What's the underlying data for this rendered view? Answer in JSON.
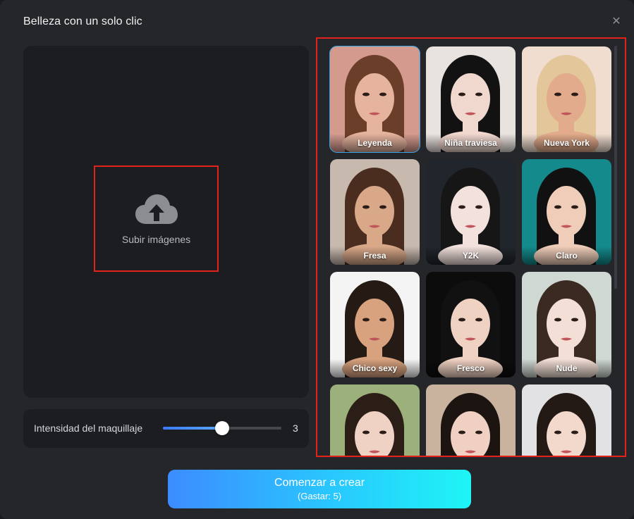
{
  "dialog": {
    "title": "Belleza con un solo clic",
    "close_glyph": "✕"
  },
  "upload": {
    "label": "Subir imágenes",
    "icon": "cloud-upload-icon"
  },
  "intensity": {
    "label": "Intensidad del maquillaje",
    "value": "3",
    "level_fraction": 0.5
  },
  "styles": [
    {
      "label": "Leyenda",
      "selected": true,
      "bg": "#d49a8e",
      "skin": "#e5b39e",
      "hair": "#6b3e2a"
    },
    {
      "label": "Niña traviesa",
      "selected": false,
      "bg": "#e9e3df",
      "skin": "#f1d8cf",
      "hair": "#121212"
    },
    {
      "label": "Nueva York",
      "selected": false,
      "bg": "#f0ddd0",
      "skin": "#e2ab8b",
      "hair": "#e3c79a"
    },
    {
      "label": "Fresa",
      "selected": false,
      "bg": "#c8b9ae",
      "skin": "#d9a889",
      "hair": "#4a2d1f"
    },
    {
      "label": "Y2K",
      "selected": false,
      "bg": "#20262c",
      "skin": "#f2e1dc",
      "hair": "#161616"
    },
    {
      "label": "Claro",
      "selected": false,
      "bg": "#148a8c",
      "skin": "#efcdb9",
      "hair": "#111111"
    },
    {
      "label": "Chico sexy",
      "selected": false,
      "bg": "#f4f4f4",
      "skin": "#d8a27f",
      "hair": "#251a14"
    },
    {
      "label": "Fresco",
      "selected": false,
      "bg": "#0c0c0c",
      "skin": "#f0d2c2",
      "hair": "#111111"
    },
    {
      "label": "Nude",
      "selected": false,
      "bg": "#cfd8d2",
      "skin": "#f3dfd6",
      "hair": "#3a2a22"
    },
    {
      "label": "",
      "selected": false,
      "bg": "#9bb07a",
      "skin": "#f0d2c4",
      "hair": "#2b1e16"
    },
    {
      "label": "",
      "selected": false,
      "bg": "#c9b39f",
      "skin": "#f0d0c2",
      "hair": "#1c1410"
    },
    {
      "label": "",
      "selected": false,
      "bg": "#e2e2e4",
      "skin": "#f3d8cc",
      "hair": "#231915"
    }
  ],
  "cta": {
    "main": "Comenzar a crear",
    "sub": "(Gastar: 5)"
  },
  "colors": {
    "accent_blue": "#3c8cff",
    "accent_cyan": "#1ef5f5",
    "highlight_red": "#e3231b",
    "selected_border": "#3aa6e8"
  }
}
